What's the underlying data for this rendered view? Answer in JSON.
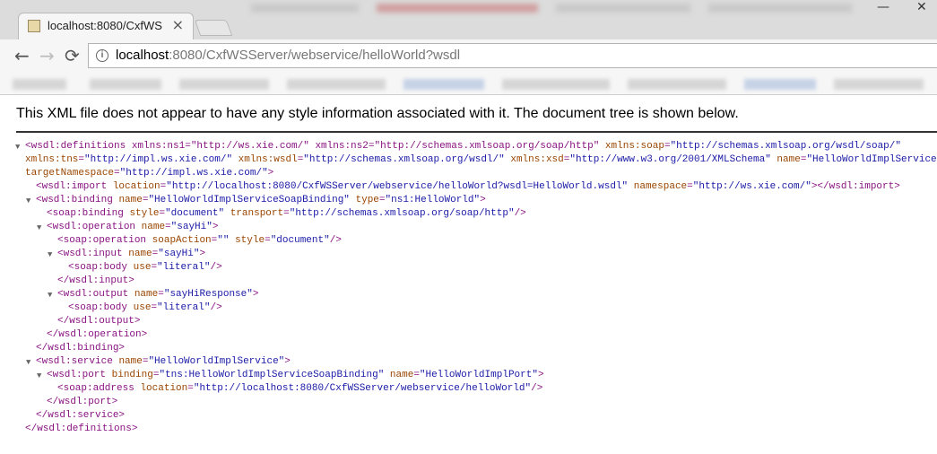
{
  "tab": {
    "title": "localhost:8080/CxfWS",
    "close": "×"
  },
  "window": {
    "minimize": "—",
    "close": "✕"
  },
  "toolbar": {
    "back": "←",
    "forward": "→",
    "reload": "⟳"
  },
  "address": {
    "host": "localhost",
    "rest": ":8080/CxfWSServer/webservice/helloWorld?wsdl"
  },
  "notice": "This XML file does not appear to have any style information associated with it. The document tree is shown below.",
  "xml_lines": [
    {
      "indent": 0,
      "toggle": true,
      "text": "<wsdl:definitions xmlns:ns1=\"http://ws.xie.com/\" xmlns:ns2=\"http://schemas.xmlsoap.org/soap/http\" xmlns:soap=\"http://schemas.xmlsoap.org/wsdl/soap/\""
    },
    {
      "indent": 0,
      "toggle": false,
      "cont": true,
      "text": "xmlns:tns=\"http://impl.ws.xie.com/\" xmlns:wsdl=\"http://schemas.xmlsoap.org/wsdl/\" xmlns:xsd=\"http://www.w3.org/2001/XMLSchema\" name=\"HelloWorldImplService\""
    },
    {
      "indent": 0,
      "toggle": false,
      "cont": true,
      "text": "targetNamespace=\"http://impl.ws.xie.com/\">"
    },
    {
      "indent": 1,
      "toggle": false,
      "text": "<wsdl:import location=\"http://localhost:8080/CxfWSServer/webservice/helloWorld?wsdl=HelloWorld.wsdl\" namespace=\"http://ws.xie.com/\"></wsdl:import>"
    },
    {
      "indent": 1,
      "toggle": true,
      "text": "<wsdl:binding name=\"HelloWorldImplServiceSoapBinding\" type=\"ns1:HelloWorld\">"
    },
    {
      "indent": 2,
      "toggle": false,
      "text": "<soap:binding style=\"document\" transport=\"http://schemas.xmlsoap.org/soap/http\"/>"
    },
    {
      "indent": 2,
      "toggle": true,
      "text": "<wsdl:operation name=\"sayHi\">"
    },
    {
      "indent": 3,
      "toggle": false,
      "text": "<soap:operation soapAction=\"\" style=\"document\"/>"
    },
    {
      "indent": 3,
      "toggle": true,
      "text": "<wsdl:input name=\"sayHi\">"
    },
    {
      "indent": 4,
      "toggle": false,
      "text": "<soap:body use=\"literal\"/>"
    },
    {
      "indent": 3,
      "toggle": false,
      "text": "</wsdl:input>"
    },
    {
      "indent": 3,
      "toggle": true,
      "text": "<wsdl:output name=\"sayHiResponse\">"
    },
    {
      "indent": 4,
      "toggle": false,
      "text": "<soap:body use=\"literal\"/>"
    },
    {
      "indent": 3,
      "toggle": false,
      "text": "</wsdl:output>"
    },
    {
      "indent": 2,
      "toggle": false,
      "text": "</wsdl:operation>"
    },
    {
      "indent": 1,
      "toggle": false,
      "text": "</wsdl:binding>"
    },
    {
      "indent": 1,
      "toggle": true,
      "text": "<wsdl:service name=\"HelloWorldImplService\">"
    },
    {
      "indent": 2,
      "toggle": true,
      "text": "<wsdl:port binding=\"tns:HelloWorldImplServiceSoapBinding\" name=\"HelloWorldImplPort\">"
    },
    {
      "indent": 3,
      "toggle": false,
      "text": "<soap:address location=\"http://localhost:8080/CxfWSServer/webservice/helloWorld\"/>"
    },
    {
      "indent": 2,
      "toggle": false,
      "text": "</wsdl:port>"
    },
    {
      "indent": 1,
      "toggle": false,
      "text": "</wsdl:service>"
    },
    {
      "indent": 0,
      "toggle": false,
      "text": "</wsdl:definitions>"
    }
  ],
  "colors": {
    "tag": "#881280",
    "attr_name": "#994500",
    "attr_value": "#1a1aa6"
  }
}
